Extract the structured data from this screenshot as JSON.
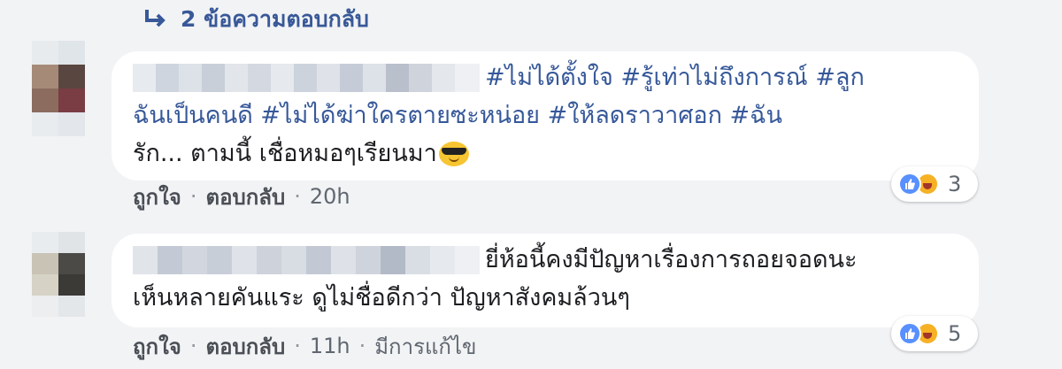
{
  "replies_link": {
    "label": "2 ข้อความตอบกลับ"
  },
  "comments": [
    {
      "text_lines": [
        "#ไม่ได้ตั้งใจ #รู้เท่าไม่ถึงการณ์ #ลูก",
        "ฉันเป็นคนดี #ไม่ได้ฆ่าใครตายซะหน่อย #ให้ลดราวาศอก #ฉัน",
        "รัก... ตามนี้ เชื่อหมอๆเรียนมา"
      ],
      "actions": {
        "like": "ถูกใจ",
        "reply": "ตอบกลับ",
        "time": "20h"
      },
      "reaction_count": "3"
    },
    {
      "text_lines": [
        "ยี่ห้อนี้คงมีปัญหาเรื่องการถอยจอดนะ",
        "เห็นหลายคันแระ ดูไม่ชื่อดีกว่า ปัญหาสังคมล้วนๆ"
      ],
      "actions": {
        "like": "ถูกใจ",
        "reply": "ตอบกลับ",
        "time": "11h",
        "edited": "มีการแก้ไข"
      },
      "reaction_count": "5"
    }
  ],
  "colors": {
    "background": "#f2f3f5",
    "link_blue": "#385898",
    "hashtag_blue": "#365899",
    "like_blue": "#5890ff",
    "haha_yellow": "#f7b125",
    "meta_gray": "#606770"
  },
  "icons": [
    "reply-arrow-icon",
    "like-reaction-icon",
    "haha-reaction-icon",
    "sunglasses-emoji-icon"
  ]
}
